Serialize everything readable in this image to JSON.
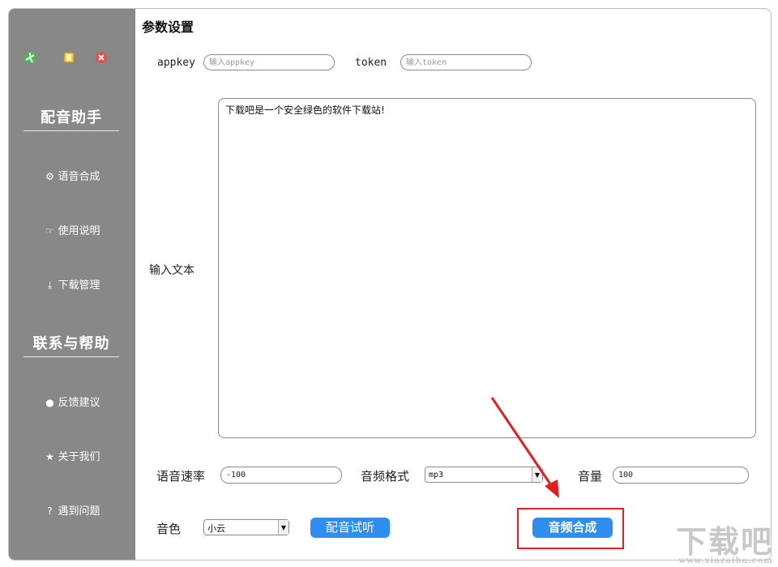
{
  "sidebar": {
    "window_buttons": [
      {
        "name": "minimize",
        "color": "#3cc04a"
      },
      {
        "name": "maximize",
        "color": "#f2c84b"
      },
      {
        "name": "close",
        "color": "#e0504a"
      }
    ],
    "section1_title": "配音助手",
    "section2_title": "联系与帮助",
    "items": [
      {
        "label": "语音合成",
        "icon": "gear-icon"
      },
      {
        "label": "使用说明",
        "icon": "thumbs-up-icon"
      },
      {
        "label": "下载管理",
        "icon": "download-icon"
      },
      {
        "label": "反馈建议",
        "icon": "comment-icon"
      },
      {
        "label": "关于我们",
        "icon": "star-icon"
      },
      {
        "label": "遇到问题",
        "icon": "question-icon"
      }
    ]
  },
  "main": {
    "title": "参数设置",
    "appkey_label": "appkey",
    "appkey_placeholder": "输入appkey",
    "token_label": "token",
    "token_placeholder": "输入token",
    "text_label": "输入文本",
    "text_value": "下载吧是一个安全绿色的软件下载站!",
    "speed_label": "语音速率",
    "speed_value": "-100",
    "format_label": "音频格式",
    "format_value": "mp3",
    "volume_label": "音量",
    "volume_value": "100",
    "voice_label": "音色",
    "voice_value": "小云",
    "preview_button": "配音试听",
    "synth_button": "音频合成"
  },
  "accent_color": "#2f8ef0",
  "annotation_color": "#e02020",
  "watermark": {
    "text": "下载吧",
    "url": "www.xiazaiba.com"
  }
}
